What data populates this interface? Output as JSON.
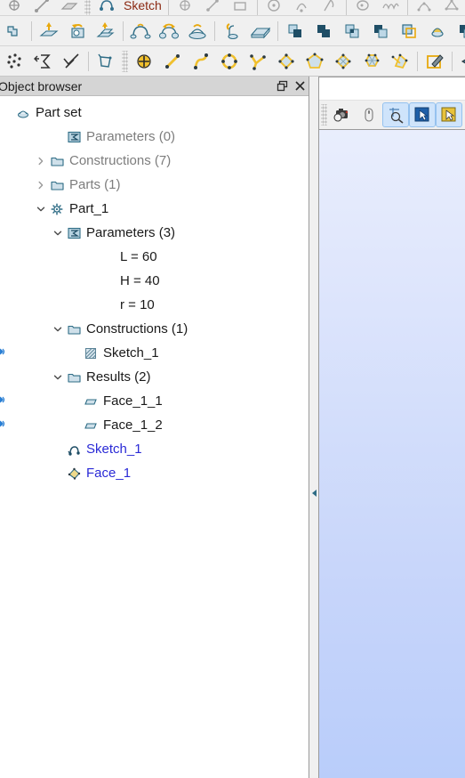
{
  "toolbars": {
    "sketch_label": "Sketch",
    "row1": {
      "name": "sketch-tools-toolbar-disabled",
      "items": [
        {
          "name": "point-icon"
        },
        {
          "name": "line-icon"
        },
        {
          "name": "plane-icon"
        },
        {
          "name": "sketch-point-icon"
        },
        {
          "name": "sketch-line-icon"
        },
        {
          "name": "rectangle-icon"
        },
        {
          "name": "circle-icon"
        },
        {
          "name": "arc-icon"
        },
        {
          "name": "ellipse-icon"
        },
        {
          "name": "ellipse-arc-icon"
        },
        {
          "name": "spline-icon"
        },
        {
          "name": "bspline-icon"
        },
        {
          "name": "projection-icon"
        }
      ]
    },
    "row2": {
      "name": "features-toolbar",
      "items": [
        {
          "name": "group-icon"
        },
        {
          "name": "extrusion-icon"
        },
        {
          "name": "extrusion-cut-icon"
        },
        {
          "name": "extrusion-fuse-icon"
        },
        {
          "name": "revolution-icon"
        },
        {
          "name": "revolution-cut-icon"
        },
        {
          "name": "revolution-fuse-icon"
        },
        {
          "name": "pipe-icon"
        },
        {
          "name": "box-icon"
        },
        {
          "name": "boolean-cut-icon"
        },
        {
          "name": "boolean-fuse-icon"
        },
        {
          "name": "boolean-common-icon"
        },
        {
          "name": "boolean-smash-icon"
        },
        {
          "name": "boolean-fill-icon"
        },
        {
          "name": "partition-icon"
        },
        {
          "name": "boolean-split-icon"
        }
      ]
    },
    "row3": {
      "name": "sketch-creation-toolbar",
      "items": [
        {
          "name": "multi-point-icon"
        },
        {
          "name": "sum-icon"
        },
        {
          "name": "check-icon"
        },
        {
          "name": "sketch-face-icon"
        },
        {
          "name": "point-add-icon"
        },
        {
          "name": "line-draw-icon"
        },
        {
          "name": "arc-draw-icon"
        },
        {
          "name": "circle-draw-icon"
        },
        {
          "name": "polyline-icon"
        },
        {
          "name": "quad-face-icon"
        },
        {
          "name": "pentagon-face-icon"
        },
        {
          "name": "fillet-icon"
        },
        {
          "name": "multi-fillet-icon"
        },
        {
          "name": "split-sketch-icon"
        },
        {
          "name": "sketch-edit-icon"
        },
        {
          "name": "mirror-icon"
        }
      ]
    }
  },
  "object_browser": {
    "title": "Object browser",
    "float_button": "float-button",
    "close_button": "close-button",
    "tree": [
      {
        "label": "Part set",
        "indent": 0,
        "twisty": "none",
        "icon": "partset-icon",
        "style": "normal",
        "eye": false
      },
      {
        "label": "Parameters (0)",
        "indent": 3,
        "twisty": "none",
        "icon": "parameters-icon",
        "style": "muted",
        "eye": false
      },
      {
        "label": "Constructions (7)",
        "indent": 2,
        "twisty": "collapsed",
        "icon": "folder-icon",
        "style": "muted",
        "eye": false
      },
      {
        "label": "Parts (1)",
        "indent": 2,
        "twisty": "collapsed",
        "icon": "folder-icon",
        "style": "muted",
        "eye": false
      },
      {
        "label": "Part_1",
        "indent": 2,
        "twisty": "expanded",
        "icon": "part-icon",
        "style": "normal",
        "eye": false
      },
      {
        "label": "Parameters (3)",
        "indent": 3,
        "twisty": "expanded",
        "icon": "parameters-icon",
        "style": "normal",
        "eye": false
      },
      {
        "label": "L = 60",
        "indent": 5,
        "twisty": "none",
        "icon": "none",
        "style": "normal",
        "eye": false
      },
      {
        "label": "H = 40",
        "indent": 5,
        "twisty": "none",
        "icon": "none",
        "style": "normal",
        "eye": false
      },
      {
        "label": "r = 10",
        "indent": 5,
        "twisty": "none",
        "icon": "none",
        "style": "normal",
        "eye": false
      },
      {
        "label": "Constructions (1)",
        "indent": 3,
        "twisty": "expanded",
        "icon": "folder-icon",
        "style": "normal",
        "eye": false
      },
      {
        "label": "Sketch_1",
        "indent": 4,
        "twisty": "none",
        "icon": "sketch-construction-icon",
        "style": "normal",
        "eye": true
      },
      {
        "label": "Results (2)",
        "indent": 3,
        "twisty": "expanded",
        "icon": "folder-icon",
        "style": "normal",
        "eye": false
      },
      {
        "label": "Face_1_1",
        "indent": 4,
        "twisty": "none",
        "icon": "face-result-icon",
        "style": "normal",
        "eye": true
      },
      {
        "label": "Face_1_2",
        "indent": 4,
        "twisty": "none",
        "icon": "face-result-icon",
        "style": "normal",
        "eye": true
      },
      {
        "label": "Sketch_1",
        "indent": 3,
        "twisty": "none",
        "icon": "sketch-feature-icon",
        "style": "blue",
        "eye": false
      },
      {
        "label": "Face_1",
        "indent": 3,
        "twisty": "none",
        "icon": "face-feature-icon",
        "style": "blue",
        "eye": false
      }
    ]
  },
  "viewer": {
    "name": "3d-viewer",
    "toolbar": [
      {
        "name": "dump-view-icon",
        "active": false
      },
      {
        "name": "interaction-style-icon",
        "active": false
      },
      {
        "name": "zoom-select-icon",
        "active": true
      },
      {
        "name": "selection-pointer-icon",
        "active": true
      },
      {
        "name": "highlight-pointer-icon",
        "active": true
      }
    ]
  },
  "colors": {
    "accent_blue": "#2a2ad6",
    "icon_outline": "#2e6c85",
    "icon_fill": "#bcd8e6",
    "icon_yellow": "#f0b323",
    "sketch_label": "#8b2a13",
    "viewer_gradient_top": "#e9eefd",
    "viewer_gradient_bottom": "#b9cdfa"
  }
}
